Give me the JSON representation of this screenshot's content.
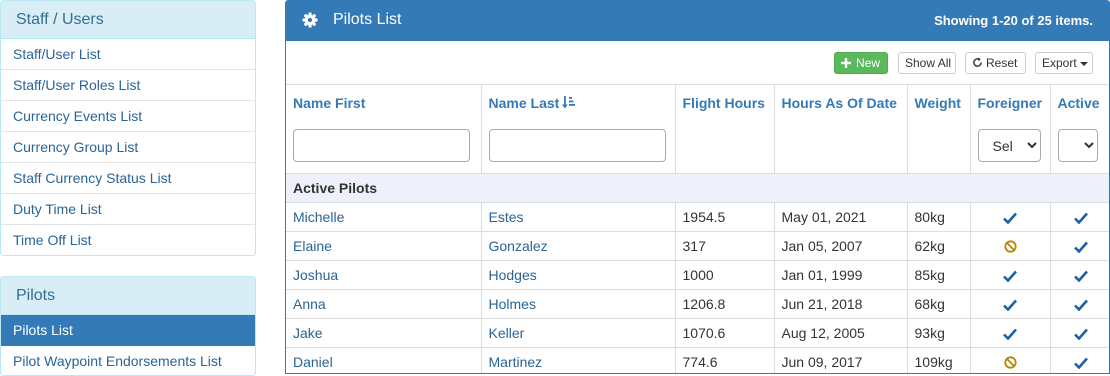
{
  "sidebar": {
    "staff_panel": {
      "title": "Staff / Users",
      "items": [
        {
          "label": "Staff/User List"
        },
        {
          "label": "Staff/User Roles List"
        },
        {
          "label": "Currency Events List"
        },
        {
          "label": "Currency Group List"
        },
        {
          "label": "Staff Currency Status List"
        },
        {
          "label": "Duty Time List"
        },
        {
          "label": "Time Off List"
        }
      ]
    },
    "pilots_panel": {
      "title": "Pilots",
      "items": [
        {
          "label": "Pilots List",
          "active": true
        },
        {
          "label": "Pilot Waypoint Endorsements List",
          "active": false
        }
      ]
    }
  },
  "main": {
    "title": "Pilots List",
    "summary": "Showing 1-20 of 25 items.",
    "toolbar": {
      "new_label": "New",
      "showall_label": "Show All",
      "reset_label": "Reset",
      "export_label": "Export"
    },
    "columns": {
      "name_first": "Name First",
      "name_last": "Name Last",
      "flight_hours": "Flight Hours",
      "hours_as_of_date": "Hours As Of Date",
      "weight": "Weight",
      "foreigner": "Foreigner",
      "active": "Active"
    },
    "filters": {
      "name_first_value": "",
      "name_last_value": "",
      "foreigner_selected": "Sel",
      "active_selected": ""
    },
    "group_label": "Active Pilots",
    "rows": [
      {
        "first": "Michelle",
        "last": "Estes",
        "hours": "1954.5",
        "date": "May 01, 2021",
        "weight": "80kg",
        "foreigner": "check",
        "active": "check"
      },
      {
        "first": "Elaine",
        "last": "Gonzalez",
        "hours": "317",
        "date": "Jan 05, 2007",
        "weight": "62kg",
        "foreigner": "ban",
        "active": "check"
      },
      {
        "first": "Joshua",
        "last": "Hodges",
        "hours": "1000",
        "date": "Jan 01, 1999",
        "weight": "85kg",
        "foreigner": "check",
        "active": "check"
      },
      {
        "first": "Anna",
        "last": "Holmes",
        "hours": "1206.8",
        "date": "Jun 21, 2018",
        "weight": "68kg",
        "foreigner": "check",
        "active": "check"
      },
      {
        "first": "Jake",
        "last": "Keller",
        "hours": "1070.6",
        "date": "Aug 12, 2005",
        "weight": "93kg",
        "foreigner": "check",
        "active": "check"
      },
      {
        "first": "Daniel",
        "last": "Martinez",
        "hours": "774.6",
        "date": "Jun 09, 2017",
        "weight": "109kg",
        "foreigner": "ban",
        "active": "check"
      }
    ]
  },
  "colors": {
    "primary": "#337ab7",
    "success": "#5cb85c",
    "info_bg": "#d9edf7",
    "check": "#1f5fa8",
    "ban": "#b8860b"
  }
}
